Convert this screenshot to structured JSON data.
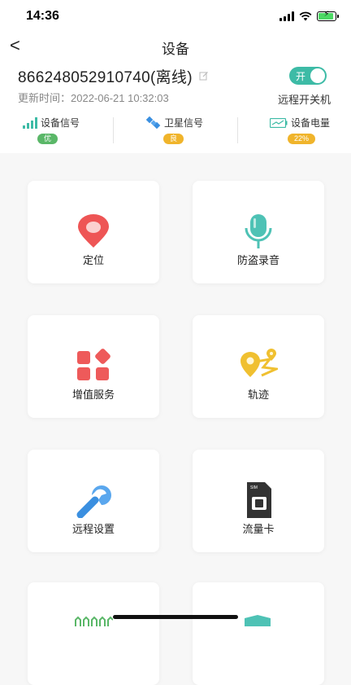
{
  "status_bar": {
    "time": "14:36"
  },
  "nav": {
    "title": "设备",
    "back_symbol": "<"
  },
  "device": {
    "id_text": "866248052910740(离线)",
    "update_time": "更新时间：2022-06-21 10:32:03",
    "toggle_label": "开",
    "toggle_caption": "远程开关机"
  },
  "stats": [
    {
      "label": "设备信号",
      "badge": "优",
      "badge_color": "#4caf50"
    },
    {
      "label": "卫星信号",
      "badge": "良",
      "badge_color": "#f0b429"
    },
    {
      "label": "设备电量",
      "badge": "22%",
      "badge_color": "#f0b429"
    }
  ],
  "colors": {
    "accent": "#3dbba6",
    "location_red": "#ee5555",
    "mic_teal": "#4ec2b5",
    "track_yellow": "#f0c030",
    "wrench_blue": "#3a8fe0"
  },
  "features": [
    {
      "label": "定位",
      "icon": "location-pin-icon"
    },
    {
      "label": "防盗录音",
      "icon": "microphone-icon"
    },
    {
      "label": "增值服务",
      "icon": "apps-grid-icon"
    },
    {
      "label": "轨迹",
      "icon": "route-track-icon"
    },
    {
      "label": "远程设置",
      "icon": "wrench-icon"
    },
    {
      "label": "流量卡",
      "icon": "sim-card-icon"
    }
  ],
  "sim_icon_text": "SIM"
}
